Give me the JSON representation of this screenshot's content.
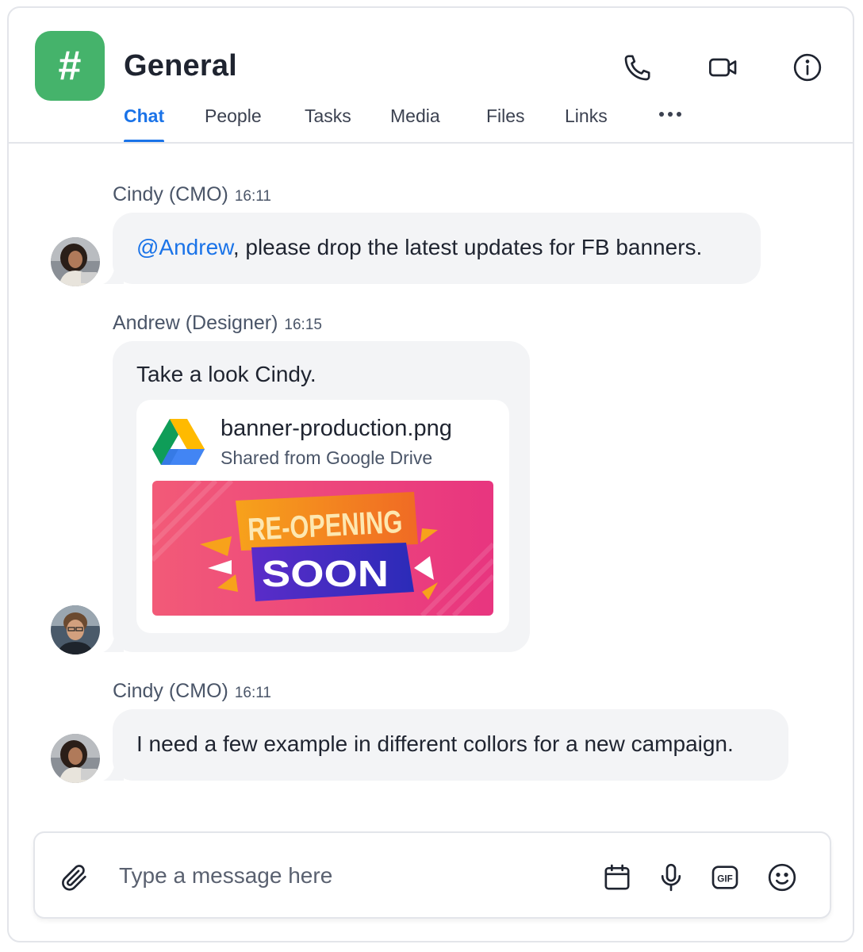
{
  "header": {
    "channel_icon_glyph": "#",
    "channel_icon_color": "#45b36b",
    "title": "General",
    "actions": [
      {
        "name": "phone-icon"
      },
      {
        "name": "video-camera-icon"
      },
      {
        "name": "info-icon"
      }
    ]
  },
  "tabs": [
    {
      "label": "Chat",
      "active": true
    },
    {
      "label": "People",
      "active": false
    },
    {
      "label": "Tasks",
      "active": false
    },
    {
      "label": "Media",
      "active": false
    },
    {
      "label": "Files",
      "active": false
    },
    {
      "label": "Links",
      "active": false
    }
  ],
  "more_icon": "more-horizontal-icon",
  "accent_color": "#1a73e8",
  "messages": [
    {
      "sender": "Cindy (CMO)",
      "time": "16:11",
      "mention": "@Andrew",
      "text": ", please drop the latest updates for FB banners."
    },
    {
      "sender": "Andrew (Designer)",
      "time": "16:15",
      "text": "Take a look Cindy.",
      "attachment": {
        "file_name": "banner-production.png",
        "source": "Shared from Google Drive",
        "banner_line1": "RE-OPENING",
        "banner_line2": "SOON"
      }
    },
    {
      "sender": "Cindy (CMO)",
      "time": "16:11",
      "text": "I need a few example in different collors for a new campaign."
    }
  ],
  "composer": {
    "placeholder": "Type a message here",
    "value": "",
    "icons": [
      "paperclip-icon",
      "calendar-icon",
      "microphone-icon",
      "gif-icon",
      "emoji-icon"
    ]
  }
}
